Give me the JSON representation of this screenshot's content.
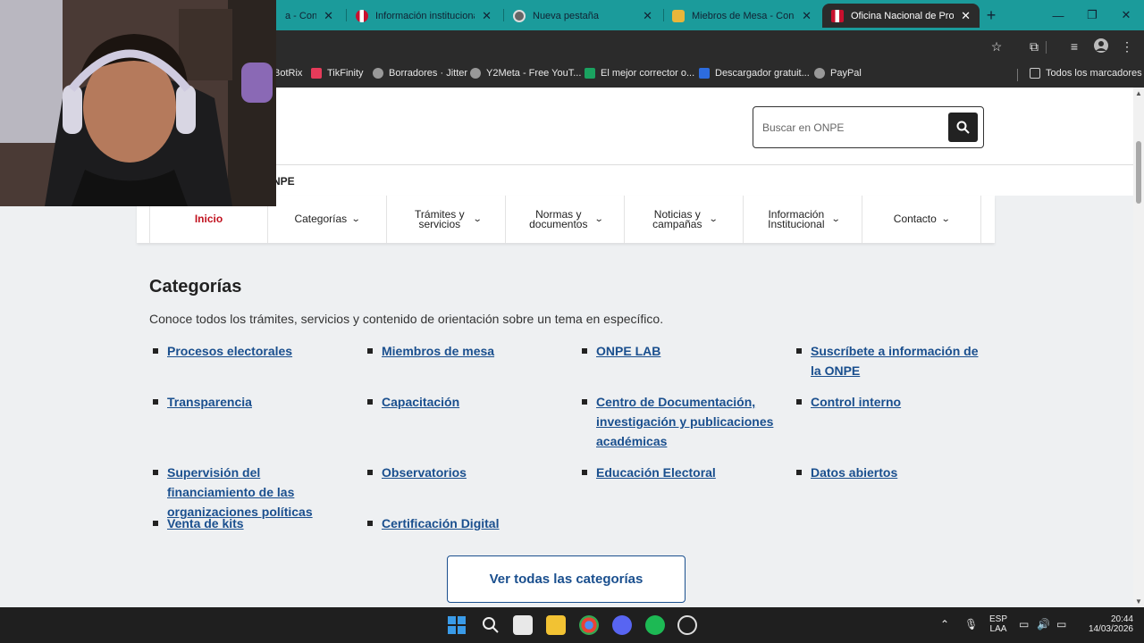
{
  "tabs": [
    {
      "title": "a - Consu",
      "color": "#c8102e"
    },
    {
      "title": "Información institucional",
      "color": "#c8102e"
    },
    {
      "title": "Nueva pestaña",
      "color": "#666666"
    },
    {
      "title": "Miebros de Mesa - Consu",
      "color": "#e8b63a"
    },
    {
      "title": "Oficina Nacional de Proce",
      "color": "#c8102e"
    }
  ],
  "bookmarks": [
    {
      "label": "BotRix",
      "color": "#8a5cf6"
    },
    {
      "label": "TikFinity",
      "color": "#e63b5a"
    },
    {
      "label": "Borradores · Jitter",
      "color": "#999999"
    },
    {
      "label": "Y2Meta - Free YouT...",
      "color": "#999999"
    },
    {
      "label": "El mejor corrector o...",
      "color": "#1aa260"
    },
    {
      "label": "Descargador gratuit...",
      "color": "#2d6cdf"
    },
    {
      "label": "PayPal",
      "color": "#999999"
    },
    {
      "label": "Todos los marcadores",
      "color": "#999999"
    }
  ],
  "header": {
    "search_placeholder": "Buscar en ONPE",
    "site_label": "NPE"
  },
  "nav": [
    {
      "label": "Inicio"
    },
    {
      "label": "Categorías"
    },
    {
      "label": "Trámites y servicios"
    },
    {
      "label": "Normas y documentos"
    },
    {
      "label": "Noticias y campañas"
    },
    {
      "label": "Información Institucional"
    },
    {
      "label": "Contacto"
    }
  ],
  "main": {
    "title": "Categorías",
    "intro": "Conoce todos los trámites, servicios y contenido de orientación sobre un tema en específico.",
    "categories": [
      "Procesos electorales",
      "Miembros de mesa",
      "ONPE LAB",
      "Suscríbete a información de la ONPE",
      "Transparencia",
      "Capacitación",
      "Centro de Documentación, investigación y publicaciones académicas",
      "Control interno",
      "Supervisión del financiamiento de las organizaciones políticas",
      "Observatorios",
      "Educación Electoral",
      "Datos abiertos",
      "Venta de kits",
      "Certificación Digital"
    ],
    "all_button": "Ver todas las categorías"
  },
  "taskbar": {
    "lang_top": "ESP",
    "lang_bottom": "LAA",
    "time": "20:44",
    "date": "14/03/2026"
  }
}
